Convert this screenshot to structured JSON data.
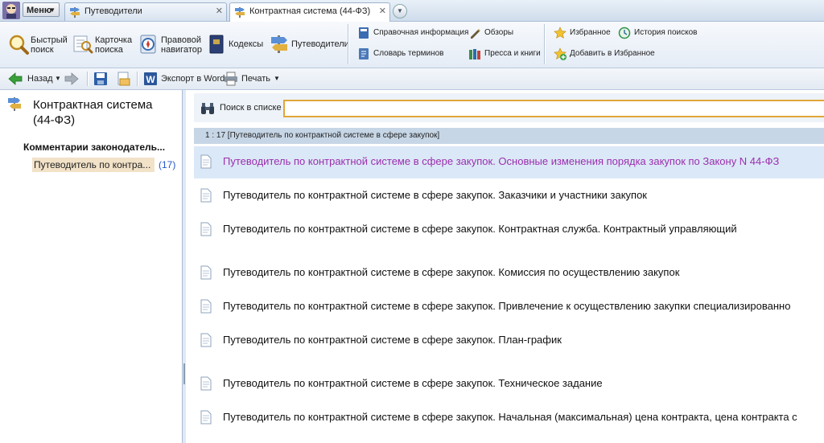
{
  "tabbar": {
    "menu_label": "Меню",
    "tabs": [
      {
        "label": "Путеводители"
      },
      {
        "label": "Контрактная система (44-ФЗ)"
      }
    ]
  },
  "ribbon": {
    "quick_search": "Быстрый\nпоиск",
    "card_search": "Карточка\nпоиска",
    "legal_navigator": "Правовой\nнавигатор",
    "codes": "Кодексы",
    "guides": "Путеводители",
    "reference_info": "Справочная информация",
    "glossary": "Словарь терминов",
    "reviews": "Обзоры",
    "press_books": "Пресса и книги",
    "favorites": "Избранное",
    "add_to_favorites": "Добавить в Избранное",
    "search_history": "История поисков"
  },
  "toolbar": {
    "back": "Назад",
    "export_word": "Экспорт в Word",
    "print": "Печать"
  },
  "left_panel": {
    "title": "Контрактная система (44-ФЗ)",
    "section": "Комментарии законодатель...",
    "item_label": "Путеводитель по контра...",
    "item_count": "(17)"
  },
  "search": {
    "label": "Поиск в списке",
    "value": ""
  },
  "list": {
    "header": "1 : 17 [Путеводитель по контрактной системе в сфере закупок]",
    "items": [
      "Путеводитель по контрактной системе в сфере закупок. Основные изменения порядка закупок по Закону N 44-ФЗ",
      "Путеводитель по контрактной системе в сфере закупок. Заказчики и участники закупок",
      "Путеводитель по контрактной системе в сфере закупок. Контрактная служба. Контрактный управляющий",
      "Путеводитель по контрактной системе в сфере закупок. Комиссия по осуществлению закупок",
      "Путеводитель по контрактной системе в сфере закупок. Привлечение к осуществлению закупки специализированно",
      "Путеводитель по контрактной системе в сфере закупок. План-график",
      "Путеводитель по контрактной системе в сфере закупок. Техническое задание",
      "Путеводитель по контрактной системе в сфере закупок. Начальная (максимальная) цена контракта, цена контракта с"
    ]
  },
  "colors": {
    "selected_link": "#9b2fae",
    "count_link": "#2255cc",
    "search_border": "#e0a63a"
  }
}
